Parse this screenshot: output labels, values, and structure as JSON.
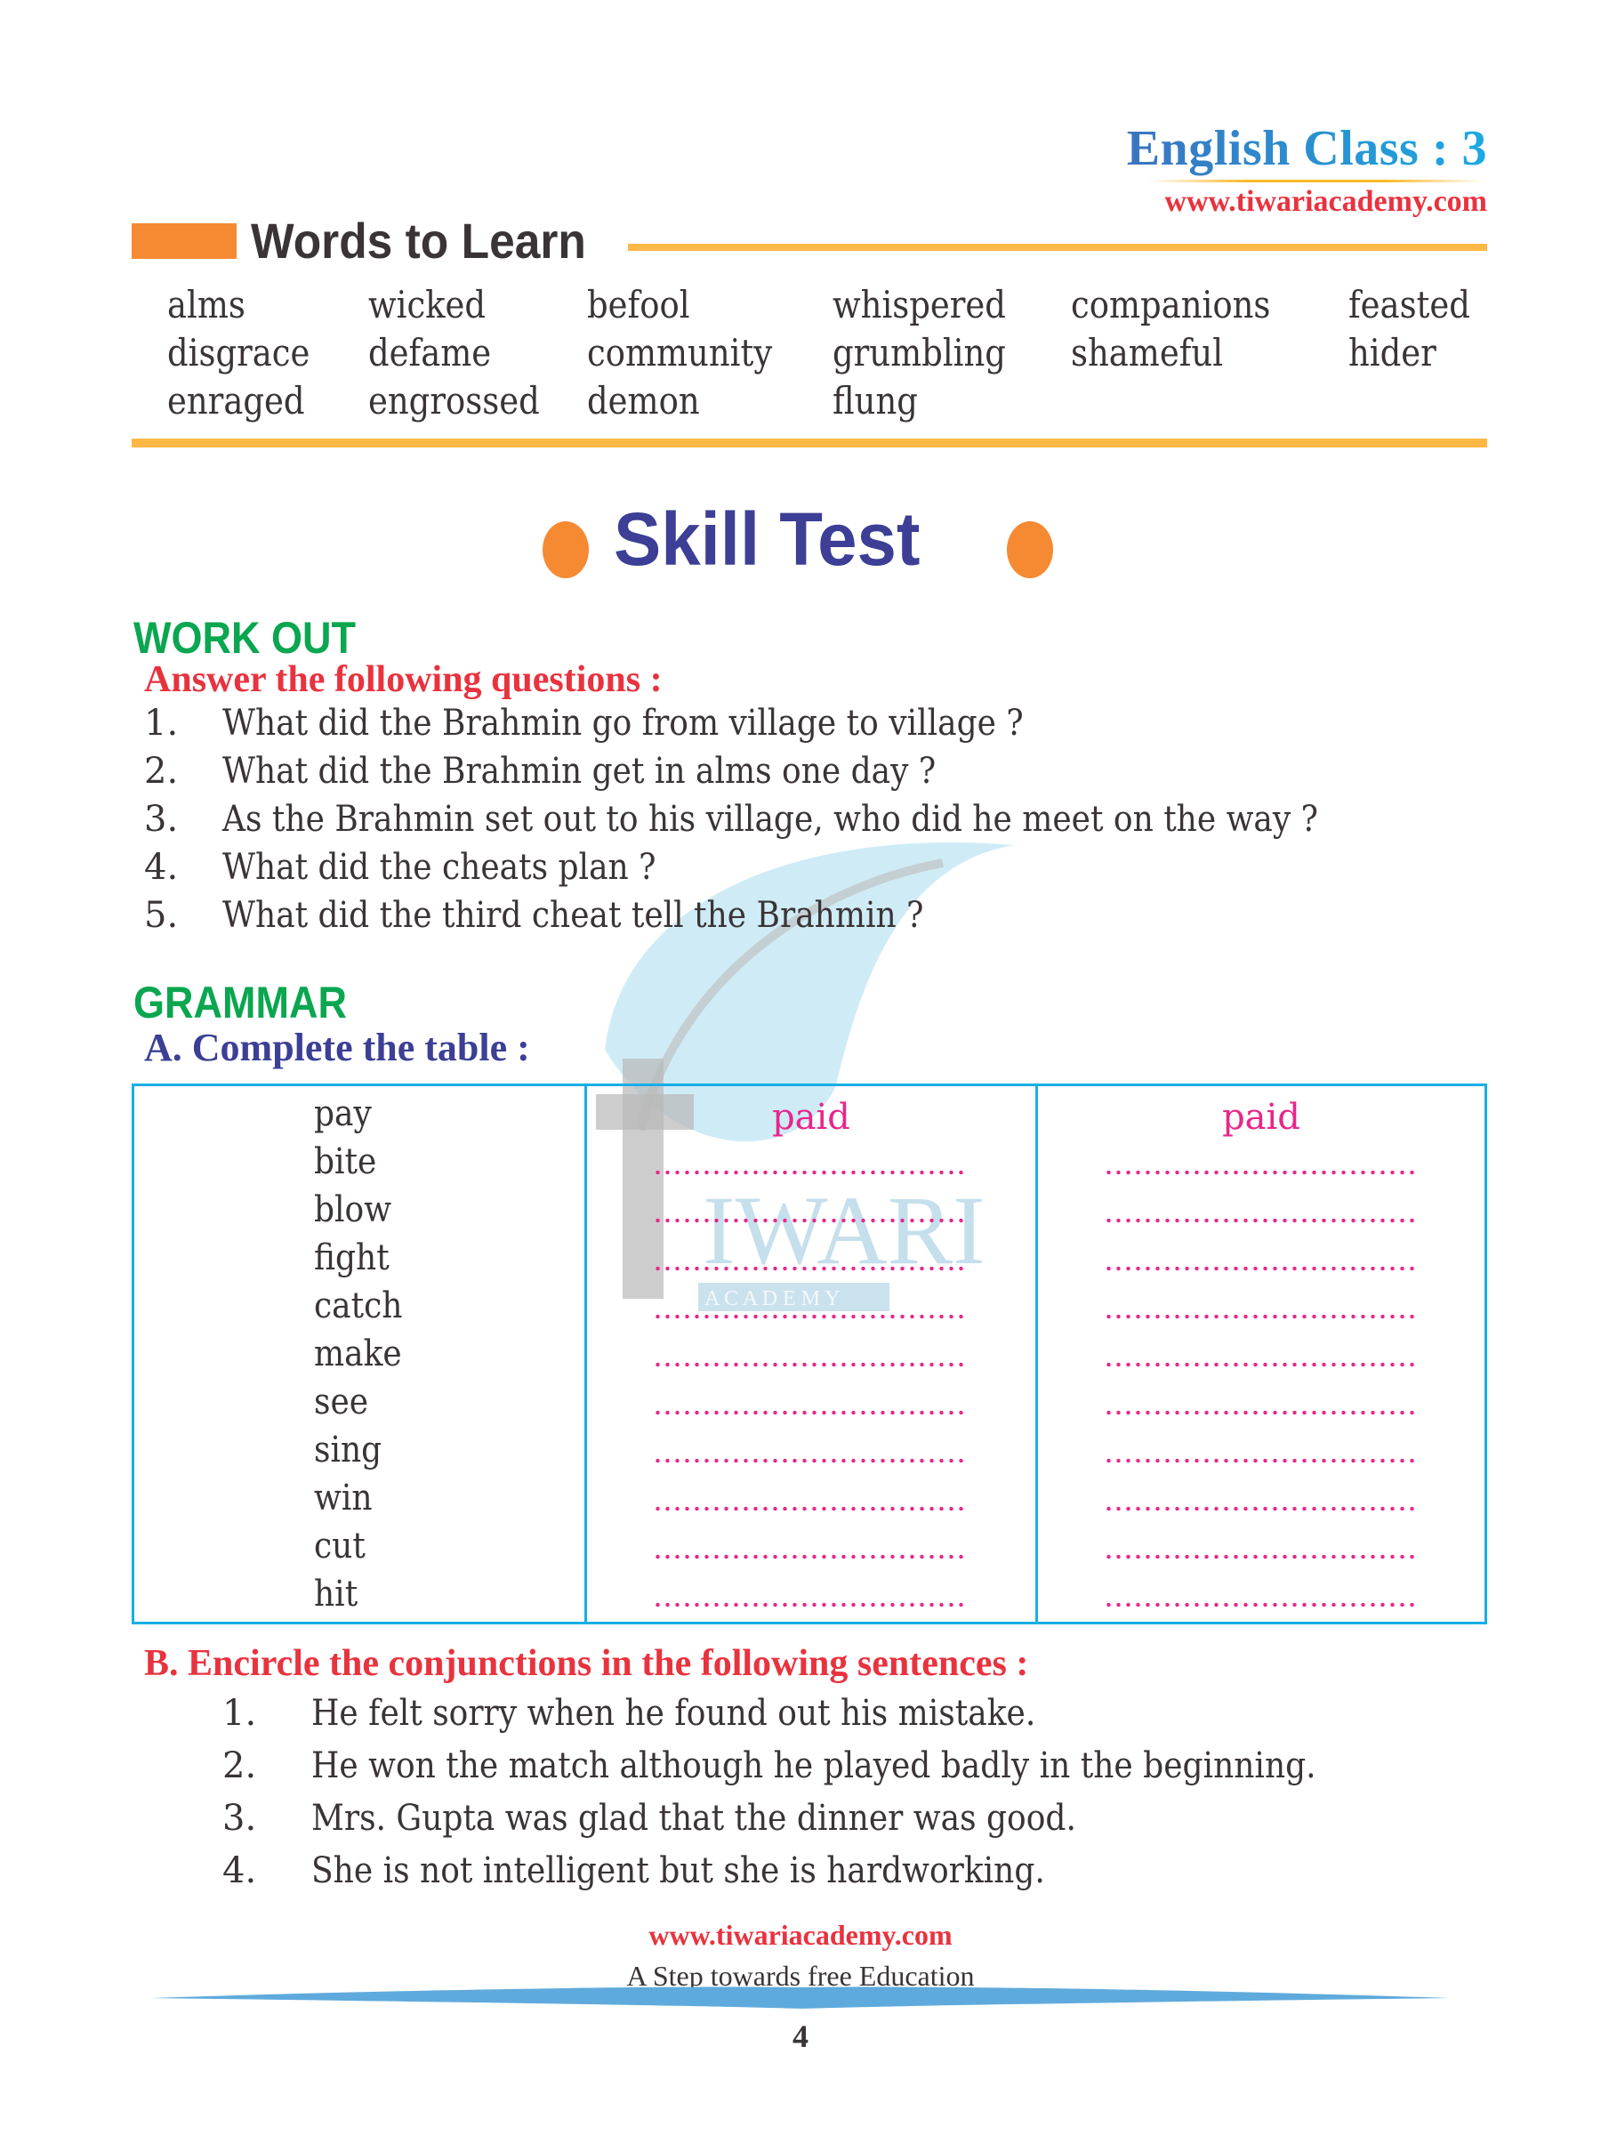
{
  "header": {
    "class_title": "English Class : 3",
    "url": "www.tiwariacademy.com"
  },
  "words_to_learn": {
    "title": "Words to Learn",
    "columns": [
      [
        "alms",
        "disgrace",
        "enraged"
      ],
      [
        "wicked",
        "defame",
        "engrossed"
      ],
      [
        "befool",
        "community",
        "demon"
      ],
      [
        "whispered",
        "grumbling",
        "flung"
      ],
      [
        "companions",
        "shameful"
      ],
      [
        "feasted",
        "hider"
      ]
    ]
  },
  "skill_test": {
    "title": "Skill Test"
  },
  "work_out": {
    "title": "WORK OUT",
    "instruction": "Answer the following questions :",
    "questions": [
      {
        "num": "1.",
        "text": "What did the Brahmin go from village to village ?"
      },
      {
        "num": "2.",
        "text": "What did the Brahmin get in alms one day ?"
      },
      {
        "num": "3.",
        "text": "As the Brahmin set out to his village, who did he meet on the way ?"
      },
      {
        "num": "4.",
        "text": "What did the cheats plan ?"
      },
      {
        "num": "5.",
        "text": "What did the third cheat tell the Brahmin ?"
      }
    ]
  },
  "grammar": {
    "title": "GRAMMAR",
    "part_a": {
      "heading": "A.   Complete the table :",
      "verbs": [
        "pay",
        "bite",
        "blow",
        "fight",
        "catch",
        "make",
        "see",
        "sing",
        "win",
        "cut",
        "hit"
      ],
      "example_past": "paid",
      "example_past_participle": "paid",
      "blank_rows": 10
    },
    "part_b": {
      "heading": "B.   Encircle the conjunctions in the following sentences :",
      "sentences": [
        {
          "num": "1.",
          "text": "He felt sorry when he found out his mistake."
        },
        {
          "num": "2.",
          "text": "He won the match although he played badly in the beginning."
        },
        {
          "num": "3.",
          "text": "Mrs. Gupta was glad that the dinner was good."
        },
        {
          "num": "4.",
          "text": "She is not intelligent but she is hardworking."
        }
      ]
    }
  },
  "footer": {
    "url": "www.tiwariacademy.com",
    "tagline": "A Step towards free Education",
    "page_number": "4"
  },
  "watermark": {
    "letter": "t",
    "brand": "IWARI",
    "sub": "A C A D E M Y"
  },
  "colors": {
    "orange": "#f68a33",
    "yellow_rule": "#fdb846",
    "navy": "#3c3f95",
    "green": "#0aa650",
    "red": "#e8333f",
    "pink": "#e8268b",
    "table_border": "#18aee6",
    "blue_title": "#2f8fd0"
  }
}
